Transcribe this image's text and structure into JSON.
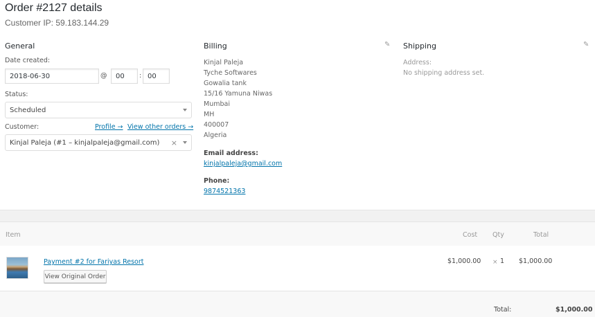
{
  "header": {
    "title": "Order #2127 details",
    "customer_ip": "Customer IP: 59.183.144.29"
  },
  "general": {
    "heading": "General",
    "date_label": "Date created:",
    "date_value": "2018-06-30",
    "at_symbol": "@",
    "hour_value": "00",
    "colon": ":",
    "minute_value": "00",
    "status_label": "Status:",
    "status_value": "Scheduled",
    "customer_label": "Customer:",
    "profile_link": "Profile →",
    "view_orders_link": "View other orders →",
    "customer_value": "Kinjal Paleja (#1 – kinjalpaleja@gmail.com)",
    "clear_symbol": "×"
  },
  "billing": {
    "heading": "Billing",
    "address_lines": [
      "Kinjal Paleja",
      "Tyche Softwares",
      "Gowalia tank",
      "15/16 Yamuna Niwas",
      "Mumbai",
      "MH",
      "400007",
      "Algeria"
    ],
    "email_label": "Email address:",
    "email_value": "kinjalpaleja@gmail.com",
    "phone_label": "Phone:",
    "phone_value": "9874521363"
  },
  "shipping": {
    "heading": "Shipping",
    "address_label": "Address:",
    "address_value": "No shipping address set."
  },
  "items": {
    "columns": {
      "item": "Item",
      "cost": "Cost",
      "qty": "Qty",
      "total": "Total"
    },
    "rows": [
      {
        "name": "Payment #2 for Fariyas Resort",
        "button": "View Original Order",
        "cost": "$1,000.00",
        "qty_prefix": "×",
        "qty": "1",
        "total": "$1,000.00"
      }
    ],
    "total_label": "Total:",
    "total_value": "$1,000.00"
  },
  "colors": {
    "link": "#0073aa",
    "band": "#f8f8f8"
  }
}
